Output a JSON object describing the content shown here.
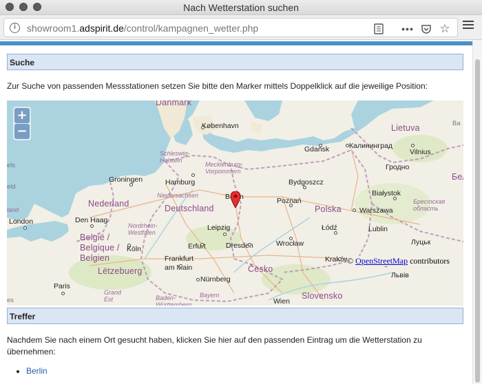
{
  "window": {
    "title": "Nach Wetterstation suchen"
  },
  "urlbar": {
    "prefix": "showroom1.",
    "domain": "adspirit.de",
    "path": "/control/kampagnen_wetter.php"
  },
  "search_section": {
    "heading": "Suche",
    "instruction": "Zur Suche von passenden Messstationen setzen Sie bitte den Marker mittels Doppelklick auf die jeweilige Position:"
  },
  "map": {
    "zoom_in": "+",
    "zoom_out": "−",
    "attribution_prefix": "©",
    "attribution_link": "OpenStreetMap",
    "attribution_suffix": "contributors",
    "marker_location": "Berlin",
    "colors": {
      "water": "#aad3df",
      "land": "#f2efe6",
      "border": "#b08cb0",
      "marker": "#d33"
    },
    "labels": {
      "danmark": "Danmark",
      "kobenhavn": "København",
      "lietuva": "Lietuva",
      "vilnius": "Vilnius",
      "kaliningrad": "Калининград",
      "gdansk": "Gdańsk",
      "grodno": "Гродно",
      "schleswig": "Schleswig-Holstein",
      "mecklenburg": "Mecklenburg-Vorpommern",
      "hamburg": "Hamburg",
      "groningen": "Groningen",
      "bydgoszcz": "Bydgoszcz",
      "bialystok": "Białystok",
      "niedersachsen": "Niedersachsen",
      "berlin": "Berlin",
      "nederland": "Nederland",
      "deutschland": "Deutschland",
      "poznan": "Poznań",
      "polska": "Polska",
      "warszawa": "Warszawa",
      "brest": "Брестская область",
      "london": "London",
      "den_haag": "Den Haag",
      "nrw": "Nordrhein-Westfalen",
      "leipzig": "Leipzig",
      "lodz": "Łódź",
      "lublin": "Lublin",
      "belgie": "België / Belgique / Belgien",
      "koln": "Köln",
      "erfurt": "Erfurt",
      "dresden": "Dresden",
      "wroclaw": "Wrocław",
      "lutsk": "Луцьк",
      "frankfurt": "Frankfurt am Main",
      "krakow": "Kraków",
      "letzebuerg": "Lëtzebuerg",
      "cesko": "Česko",
      "lviv": "Львів",
      "paris": "Paris",
      "nurnberg": "Nürnberg",
      "grand_est": "Grand Est",
      "baden": "Baden-Württemberg",
      "bayern": "Bayern",
      "slovensko": "Slovensko",
      "wien": "Wien",
      "land_left": "land",
      "els": "els",
      "eld": "eld",
      "bel": "Бел",
      "ba": "Ba",
      "es": "es"
    }
  },
  "results_section": {
    "heading": "Treffer",
    "instruction": "Nachdem Sie nach einem Ort gesucht haben, klicken Sie hier auf den passenden Eintrag um die Wetterstation zu übernehmen:",
    "results": [
      "Berlin"
    ]
  }
}
